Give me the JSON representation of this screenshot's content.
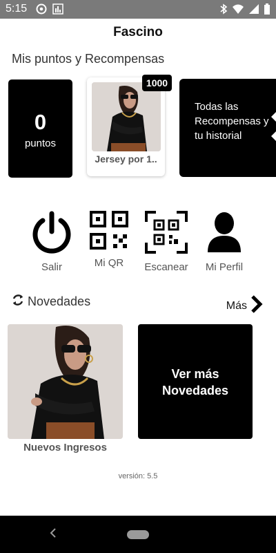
{
  "status_bar": {
    "time": "5:15",
    "left_icons": [
      "at-sign-icon",
      "bar-chart-icon"
    ],
    "right_icons": [
      "bluetooth-icon",
      "wifi-icon",
      "signal-icon",
      "battery-icon"
    ]
  },
  "header": {
    "title": "Fascino"
  },
  "rewards": {
    "section_title": "Mis puntos y Recompensas",
    "points_value": "0",
    "points_label": "puntos",
    "reward_item": {
      "name": "Jersey por 1..",
      "badge": "1000"
    },
    "all_rewards_label": "Todas las Recompensas y tu historial"
  },
  "actions": [
    {
      "label": "Salir",
      "icon": "power-icon"
    },
    {
      "label": "Mi QR",
      "icon": "qr-code-icon"
    },
    {
      "label": "Escanear",
      "icon": "scan-icon"
    },
    {
      "label": "Mi Perfil",
      "icon": "user-icon"
    }
  ],
  "news": {
    "title": "Novedades",
    "more_label": "Más",
    "card_caption": "Nuevos Ingresos",
    "see_more_label": "Ver más Novedades"
  },
  "footer": {
    "version": "versión: 5.5"
  }
}
